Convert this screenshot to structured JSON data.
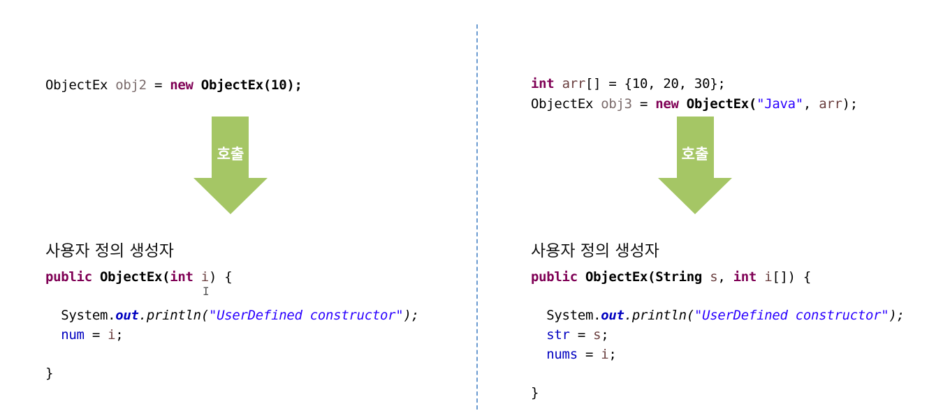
{
  "colors": {
    "arrow": "#a5c665",
    "divider": "#6a9ad0"
  },
  "left": {
    "call_line": [
      [
        "ObjectEx ",
        "plain"
      ],
      [
        "obj2",
        "lvar"
      ],
      [
        " = ",
        "plain"
      ],
      [
        "new",
        "kw"
      ],
      [
        " ObjectEx(10);",
        "cls"
      ]
    ],
    "arrow_label": "호출",
    "heading": "사용자 정의 생성자",
    "code": [
      [
        [
          "public",
          "kw"
        ],
        [
          " ObjectEx(",
          "cls"
        ],
        [
          "int",
          "kw"
        ],
        [
          " ",
          "plain"
        ],
        [
          "i",
          "var"
        ],
        [
          ") {",
          "plain"
        ]
      ],
      [
        [
          "  System.",
          "plain"
        ],
        [
          "out",
          "static"
        ],
        [
          ".println(",
          "it"
        ],
        [
          "\"UserDefined constructor\"",
          "strit"
        ],
        [
          ");",
          "it"
        ]
      ],
      [
        [
          "  ",
          "plain"
        ],
        [
          "num",
          "field"
        ],
        [
          " = ",
          "plain"
        ],
        [
          "i",
          "var"
        ],
        [
          ";",
          "plain"
        ]
      ],
      [
        [
          "}",
          "plain"
        ]
      ]
    ]
  },
  "right": {
    "call_lines": [
      [
        [
          "int",
          "kw"
        ],
        [
          " ",
          "plain"
        ],
        [
          "arr",
          "var"
        ],
        [
          "[] = {10, 20, 30};",
          "plain"
        ]
      ],
      [
        [
          "ObjectEx ",
          "plain"
        ],
        [
          "obj3",
          "lvar"
        ],
        [
          " = ",
          "plain"
        ],
        [
          "new",
          "kw"
        ],
        [
          " ObjectEx(",
          "cls"
        ],
        [
          "\"Java\"",
          "str"
        ],
        [
          ", ",
          "plain"
        ],
        [
          "arr",
          "var"
        ],
        [
          ");",
          "plain"
        ]
      ]
    ],
    "arrow_label": "호출",
    "heading": "사용자 정의 생성자",
    "code": [
      [
        [
          "public",
          "kw"
        ],
        [
          " ObjectEx(String ",
          "cls"
        ],
        [
          "s",
          "var"
        ],
        [
          ", ",
          "plain"
        ],
        [
          "int",
          "kw"
        ],
        [
          " ",
          "plain"
        ],
        [
          "i",
          "var"
        ],
        [
          "[]) {",
          "plain"
        ]
      ],
      [
        [
          "  System.",
          "plain"
        ],
        [
          "out",
          "static"
        ],
        [
          ".println(",
          "it"
        ],
        [
          "\"UserDefined constructor\"",
          "strit"
        ],
        [
          ");",
          "it"
        ]
      ],
      [
        [
          "  ",
          "plain"
        ],
        [
          "str",
          "field"
        ],
        [
          " = ",
          "plain"
        ],
        [
          "s",
          "var"
        ],
        [
          ";",
          "plain"
        ]
      ],
      [
        [
          "  ",
          "plain"
        ],
        [
          "nums",
          "field"
        ],
        [
          " = ",
          "plain"
        ],
        [
          "i",
          "var"
        ],
        [
          ";",
          "plain"
        ]
      ],
      [
        [
          "}",
          "plain"
        ]
      ]
    ]
  }
}
